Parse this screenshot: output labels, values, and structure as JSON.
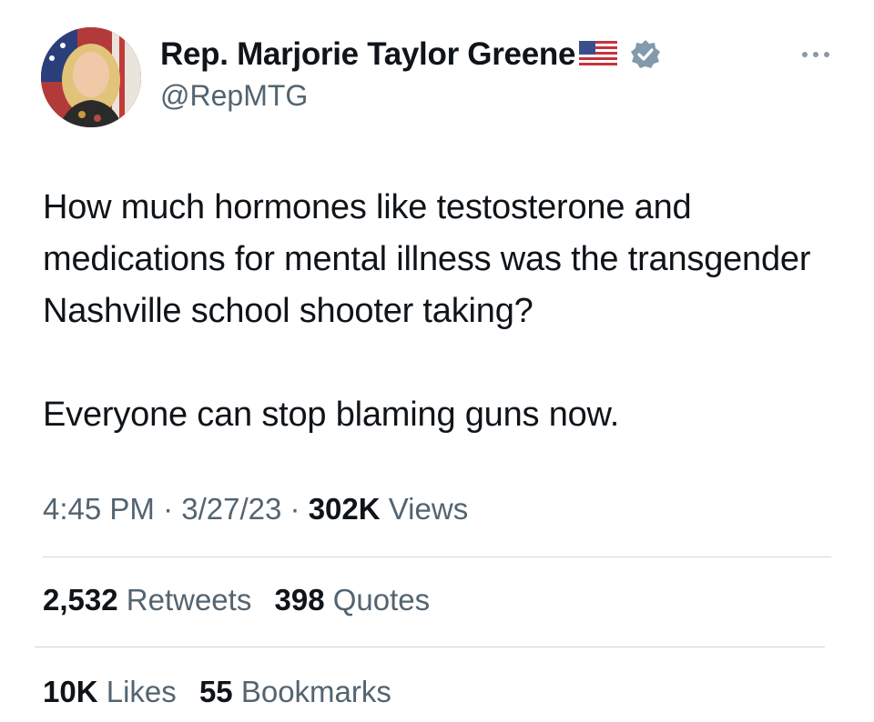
{
  "author": {
    "display_name": "Rep. Marjorie Taylor Greene",
    "handle": "@RepMTG",
    "flag_icon": "us-flag-icon",
    "badge_icon": "verified-badge-icon",
    "badge_color": "#829aab"
  },
  "tweet": {
    "paragraph_1": "How much hormones like testosterone and medications for mental illness was the transgender Nashville school shooter taking?",
    "paragraph_2": "Everyone can stop blaming guns now."
  },
  "meta": {
    "time": "4:45 PM",
    "separator": "·",
    "date": "3/27/23",
    "views_count": "302K",
    "views_label": "Views"
  },
  "stats": {
    "retweets_count": "2,532",
    "retweets_label": "Retweets",
    "quotes_count": "398",
    "quotes_label": "Quotes",
    "likes_count": "10K",
    "likes_label": "Likes",
    "bookmarks_count": "55",
    "bookmarks_label": "Bookmarks"
  }
}
